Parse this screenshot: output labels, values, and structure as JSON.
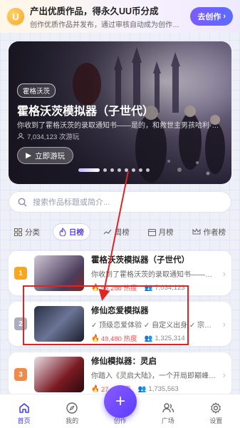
{
  "promo": {
    "icon_text": "U",
    "title": "产出优质作品，得永久UU币分成",
    "subtitle": "创作优质作品并发布，通过审核自动成为创作者，获…",
    "button_label": "去创作",
    "button_icon": "chevron-right-icon"
  },
  "hero": {
    "tag": "霍格沃茨",
    "title": "霍格沃茨模拟器（子世代）",
    "description": "你收到了霍格沃茨的录取通知书——是的，和救世主男孩哈利·波…",
    "plays": "7,034,123 次游玩",
    "play_button": "立即游玩",
    "carousel_count": 8,
    "carousel_active": 0
  },
  "search": {
    "placeholder": "搜索作品标题或简介..."
  },
  "tabs": [
    {
      "label": "分类",
      "icon": "grid-icon",
      "active": false
    },
    {
      "label": "日榜",
      "icon": "flame-icon",
      "active": true
    },
    {
      "label": "周榜",
      "icon": "trend-icon",
      "active": false
    },
    {
      "label": "月榜",
      "icon": "calendar-icon",
      "active": false
    },
    {
      "label": "作者榜",
      "icon": "crown-icon",
      "active": false
    }
  ],
  "list": [
    {
      "rank": "1",
      "rank_color": "#f5a623",
      "title": "霍格沃茨模拟器（子世代）",
      "desc": "你收到了霍格沃茨的录取通知书——是…",
      "heat": "56,288 热度",
      "users": "7,034,123"
    },
    {
      "rank": "2",
      "rank_color": "#a9adbd",
      "title": "修仙恋爱模拟器",
      "desc": "✓ 顶级恋爱体验 ✓ 自定义出身 ✓ 宗门…",
      "heat": "49,480 热度",
      "users": "1,325,314"
    },
    {
      "rank": "3",
      "rank_color": "#f08a4b",
      "title": "修仙模拟器：灵启",
      "desc": "你踏入《灵启大陆》，一个开局即巅峰…",
      "heat": "27… 热度",
      "users": "1,735,563"
    }
  ],
  "bottom_nav": [
    {
      "label": "首页",
      "icon": "home-icon",
      "active": true
    },
    {
      "label": "我的",
      "icon": "compass-icon",
      "active": false
    },
    {
      "label": "创作",
      "icon": "plus-icon",
      "active": false
    },
    {
      "label": "广场",
      "icon": "people-icon",
      "active": false
    },
    {
      "label": "设置",
      "icon": "gear-icon",
      "active": false
    }
  ],
  "fab_label": "+",
  "colors": {
    "accent": "#5b3cff",
    "heat": "#ff4d4f",
    "annotation": "#e02424"
  }
}
